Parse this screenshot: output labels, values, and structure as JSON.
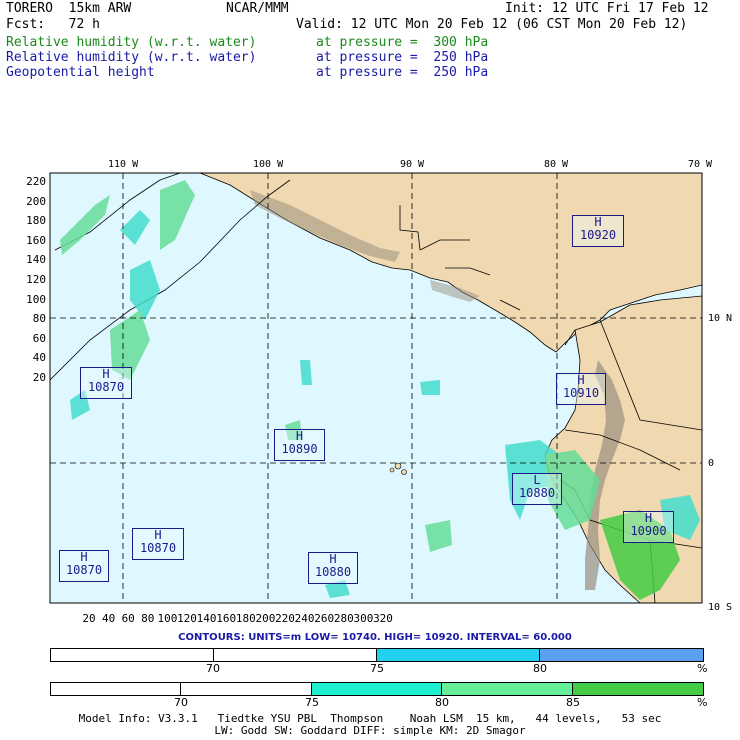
{
  "header": {
    "model": "TORERO  15km ARW",
    "org": "NCAR/MMM",
    "init": "Init: 12 UTC Fri 17 Feb 12",
    "fcst": "Fcst:   72 h",
    "valid": "Valid: 12 UTC Mon 20 Feb 12 (06 CST Mon 20 Feb 12)",
    "fields": [
      {
        "name": "Relative humidity (w.r.t. water)",
        "level": "at pressure =  300 hPa",
        "color": "#1a8a1a"
      },
      {
        "name": "Relative humidity (w.r.t. water)",
        "level": "at pressure =  250 hPa",
        "color": "#1a1aa8"
      },
      {
        "name": "Geopotential height",
        "level": "at pressure =  250 hPa",
        "color": "#1a1aa8"
      }
    ]
  },
  "map": {
    "top_lon_labels": [
      "110 W",
      "100 W",
      "90 W",
      "80 W",
      "70 W"
    ],
    "right_lat_labels": [
      "10 N",
      "0",
      "10 S"
    ],
    "y_ticks": [
      "220",
      "200",
      "180",
      "160",
      "140",
      "120",
      "100",
      "80",
      "60",
      "40",
      "20"
    ],
    "x_ticks": [
      "20",
      "40",
      "60",
      "80",
      "100",
      "120",
      "140",
      "160",
      "180",
      "200",
      "220",
      "240",
      "260",
      "280",
      "300",
      "320"
    ],
    "centers": [
      {
        "type": "H",
        "value": "10920"
      },
      {
        "type": "H",
        "value": "10870"
      },
      {
        "type": "H",
        "value": "10910"
      },
      {
        "type": "H",
        "value": "10890"
      },
      {
        "type": "L",
        "value": "10880"
      },
      {
        "type": "H",
        "value": "10870"
      },
      {
        "type": "H",
        "value": "10870"
      },
      {
        "type": "H",
        "value": "10880"
      },
      {
        "type": "H",
        "value": "10900"
      }
    ],
    "colors": {
      "ocean": "#dff8ff",
      "land": "#f0d9b0",
      "mountains": "#9a8f80"
    }
  },
  "contours": {
    "text": "CONTOURS:  UNITS=m  LOW=  10740.      HIGH=  10920.      INTERVAL=   60.000"
  },
  "colorbar_blue": {
    "labels": [
      "70",
      "75",
      "80",
      "%"
    ],
    "colors": [
      "#ffffff",
      "#ffffff",
      "#22d0f0",
      "#5aa0f0"
    ]
  },
  "colorbar_green": {
    "labels": [
      "70",
      "75",
      "80",
      "85",
      "%"
    ],
    "colors": [
      "#ffffff",
      "#ffffff",
      "#20f0d0",
      "#66ee99",
      "#44cc44"
    ]
  },
  "footer": {
    "line1": "Model Info: V3.3.1   Tiedtke YSU PBL  Thompson    Noah LSM  15 km,   44 levels,   53 sec",
    "line2": "LW: Godd SW: Goddard DIFF: simple KM: 2D Smagor"
  }
}
